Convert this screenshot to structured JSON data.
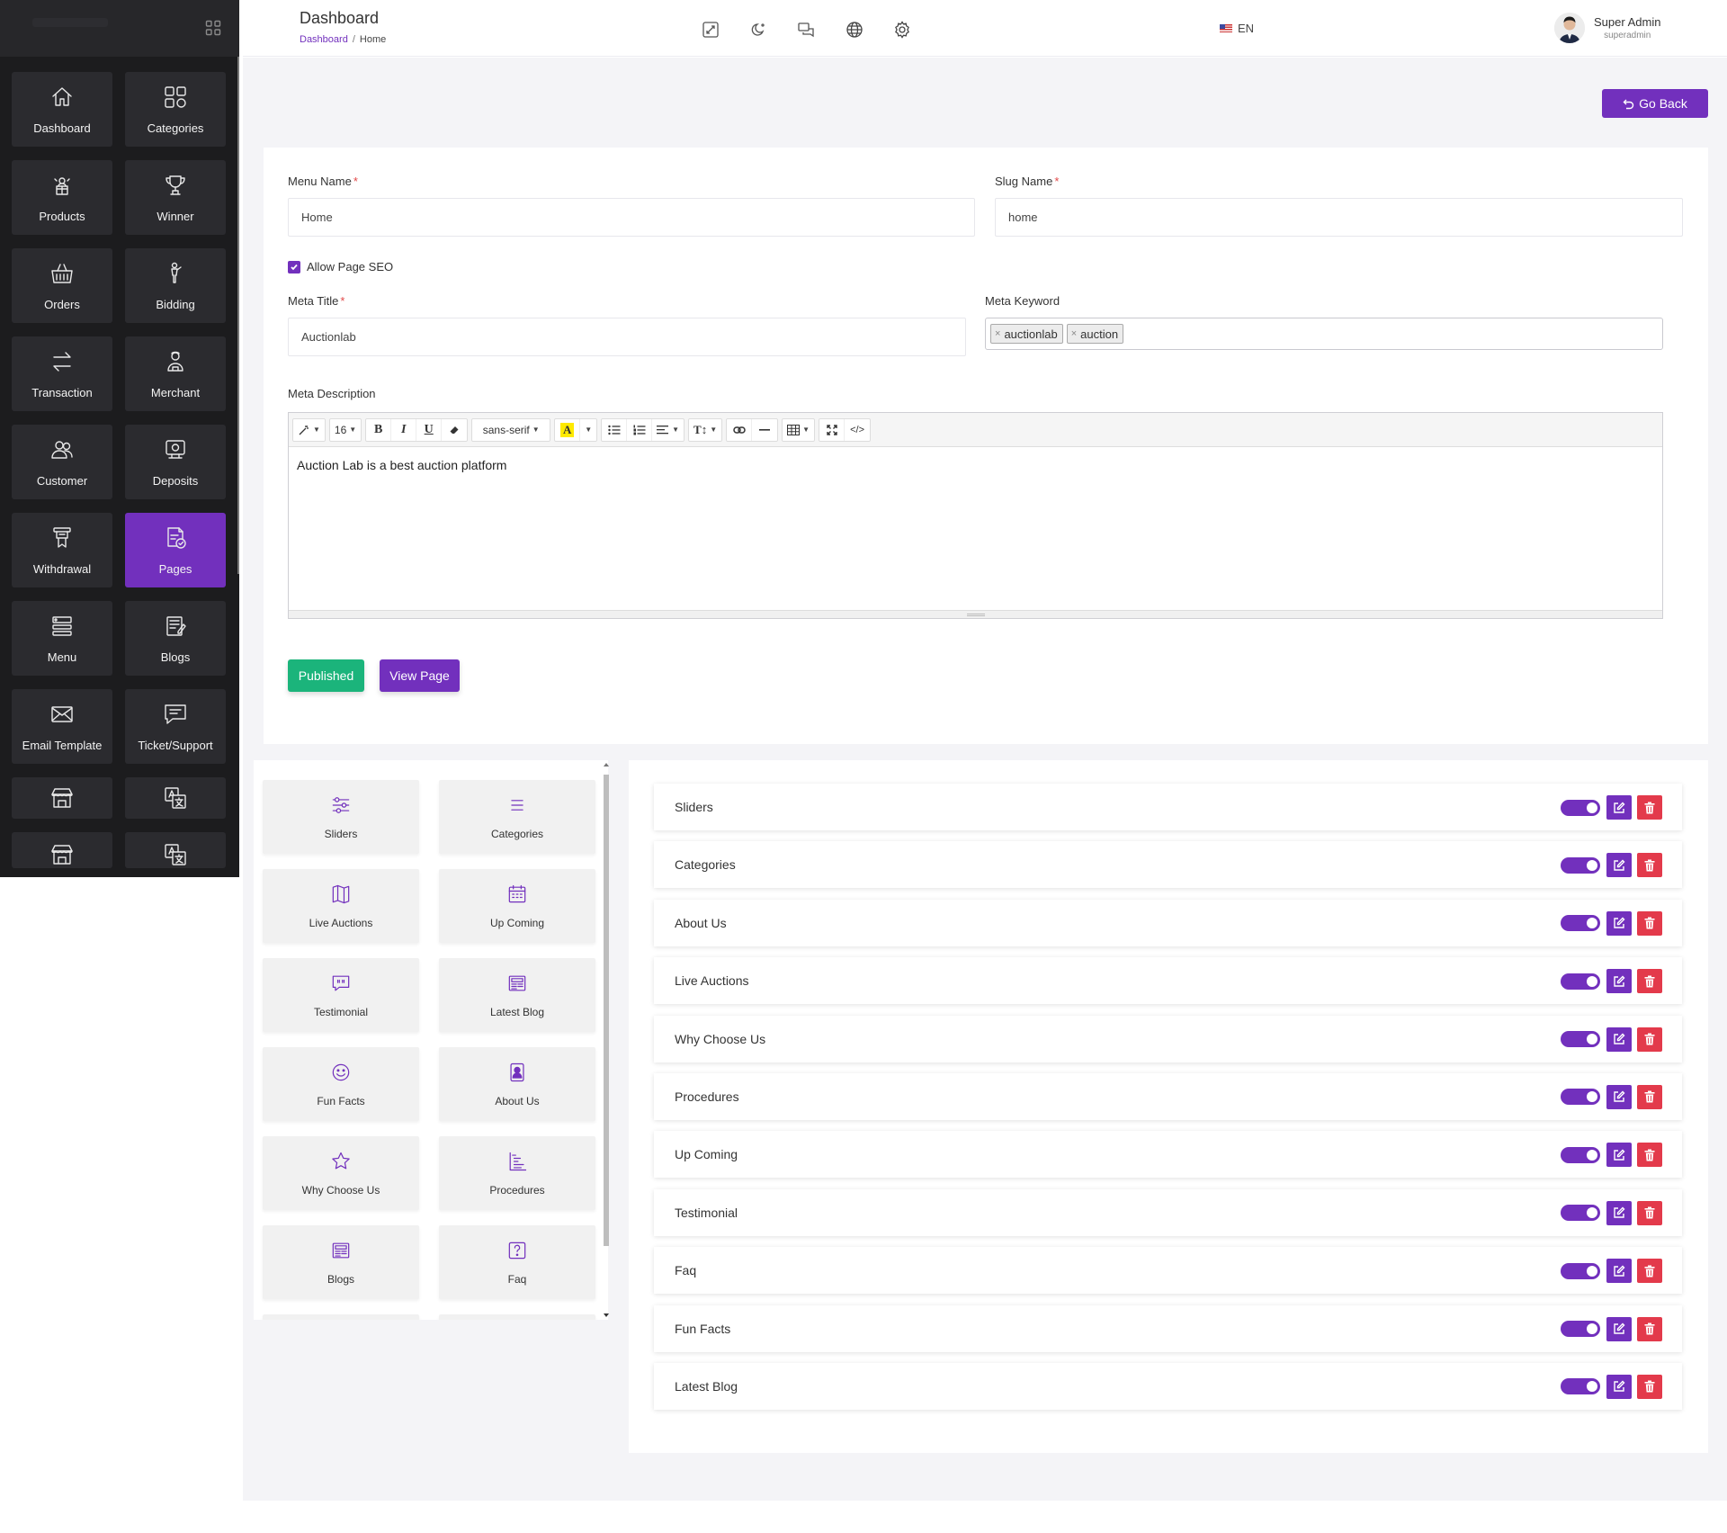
{
  "header": {
    "title": "Dashboard",
    "breadcrumb": {
      "link": "Dashboard",
      "separator": "/",
      "current": "Home"
    },
    "language": "EN",
    "user": {
      "name": "Super Admin",
      "role": "superadmin"
    }
  },
  "sidebar": {
    "items": [
      {
        "label": "Dashboard",
        "icon": "home-icon"
      },
      {
        "label": "Categories",
        "icon": "grid-icon"
      },
      {
        "label": "Products",
        "icon": "products-icon"
      },
      {
        "label": "Winner",
        "icon": "trophy-icon"
      },
      {
        "label": "Orders",
        "icon": "basket-icon"
      },
      {
        "label": "Bidding",
        "icon": "bidder-icon"
      },
      {
        "label": "Transaction",
        "icon": "exchange-arrows-icon"
      },
      {
        "label": "Merchant",
        "icon": "merchant-icon"
      },
      {
        "label": "Customer",
        "icon": "users-icon"
      },
      {
        "label": "Deposits",
        "icon": "deposit-icon"
      },
      {
        "label": "Withdrawal",
        "icon": "withdrawal-icon"
      },
      {
        "label": "Pages",
        "icon": "pages-icon",
        "active": true
      },
      {
        "label": "Menu",
        "icon": "menu-list-icon"
      },
      {
        "label": "Blogs",
        "icon": "blog-icon"
      },
      {
        "label": "Email Template",
        "icon": "envelope-icon"
      },
      {
        "label": "Ticket/Support",
        "icon": "chat-icon"
      }
    ]
  },
  "go_back_label": "Go Back",
  "form": {
    "menu_name": {
      "label": "Menu Name",
      "required": "*",
      "value": "Home"
    },
    "slug_name": {
      "label": "Slug Name",
      "required": "*",
      "value": "home"
    },
    "allow_seo_label": "Allow Page SEO",
    "meta_title": {
      "label": "Meta Title",
      "required": "*",
      "value": "Auctionlab"
    },
    "meta_keyword": {
      "label": "Meta Keyword",
      "tags": [
        "auctionlab",
        "auction"
      ]
    },
    "meta_description": {
      "label": "Meta Description",
      "font_size": "16",
      "font_family": "sans-serif",
      "content": "Auction Lab is a best auction platform"
    },
    "published_label": "Published",
    "view_page_label": "View Page"
  },
  "widgets": [
    {
      "label": "Sliders",
      "icon": "sliders-icon"
    },
    {
      "label": "Categories",
      "icon": "list-icon"
    },
    {
      "label": "Live Auctions",
      "icon": "map-icon"
    },
    {
      "label": "Up Coming",
      "icon": "calendar-icon"
    },
    {
      "label": "Testimonial",
      "icon": "quote-icon"
    },
    {
      "label": "Latest Blog",
      "icon": "newspaper-icon"
    },
    {
      "label": "Fun Facts",
      "icon": "smile-icon"
    },
    {
      "label": "About Us",
      "icon": "person-badge-icon"
    },
    {
      "label": "Why Choose Us",
      "icon": "star-icon"
    },
    {
      "label": "Procedures",
      "icon": "steps-icon"
    },
    {
      "label": "Blogs",
      "icon": "newspaper-icon"
    },
    {
      "label": "Faq",
      "icon": "question-icon"
    }
  ],
  "sections": [
    "Sliders",
    "Categories",
    "About Us",
    "Live Auctions",
    "Why Choose Us",
    "Procedures",
    "Up Coming",
    "Testimonial",
    "Faq",
    "Fun Facts",
    "Latest Blog"
  ],
  "colors": {
    "accent": "#7230bd",
    "success": "#1bb47b",
    "danger": "#e33a4b",
    "sidebar": "#1c1c1e"
  }
}
